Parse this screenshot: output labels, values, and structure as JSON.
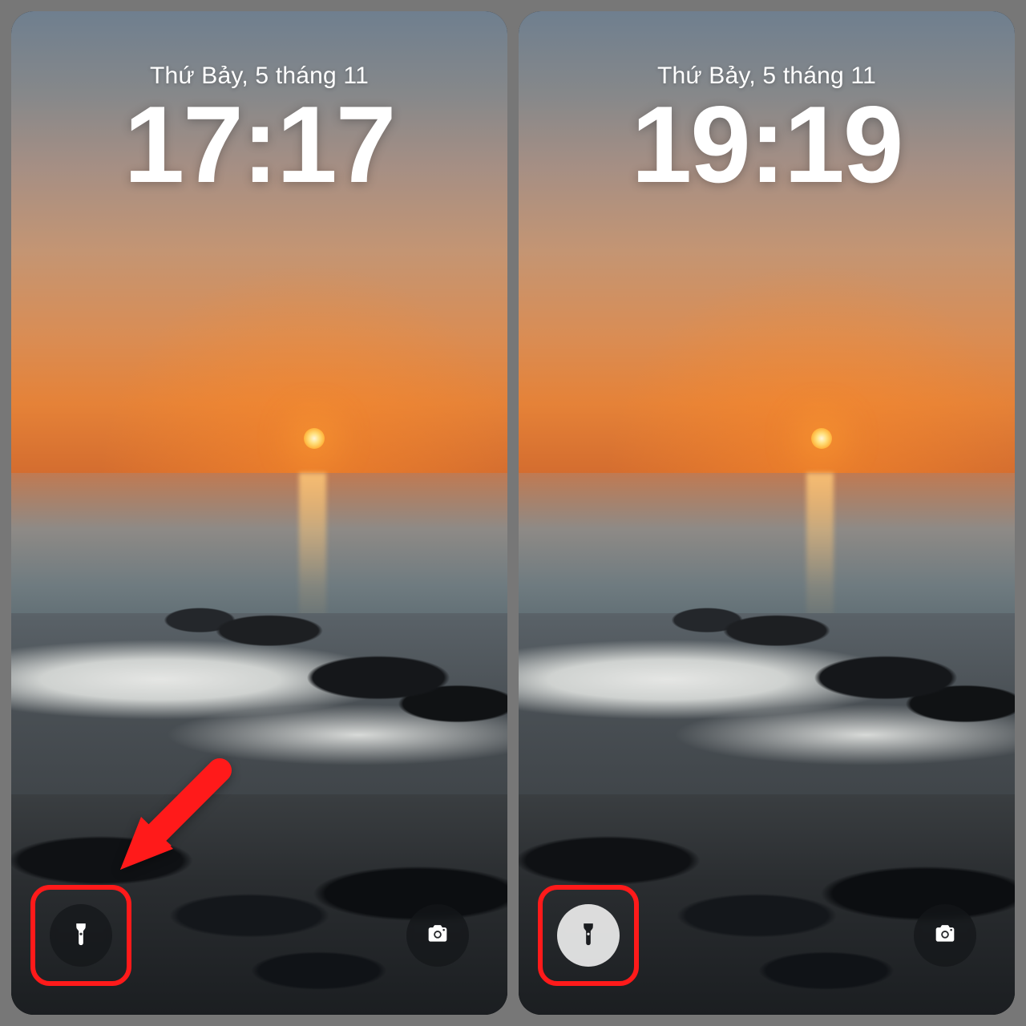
{
  "screens": [
    {
      "date": "Thứ Bảy, 5 tháng 11",
      "time": "17:17",
      "flashlight_state": "off",
      "flashlight_button_style": "dark",
      "show_arrow": true
    },
    {
      "date": "Thứ Bảy, 5 tháng 11",
      "time": "19:19",
      "flashlight_state": "on",
      "flashlight_button_style": "light",
      "show_arrow": false
    }
  ],
  "icons": {
    "flashlight": "flashlight-icon",
    "camera": "camera-icon"
  },
  "annotation_color": "#ff1a1a"
}
